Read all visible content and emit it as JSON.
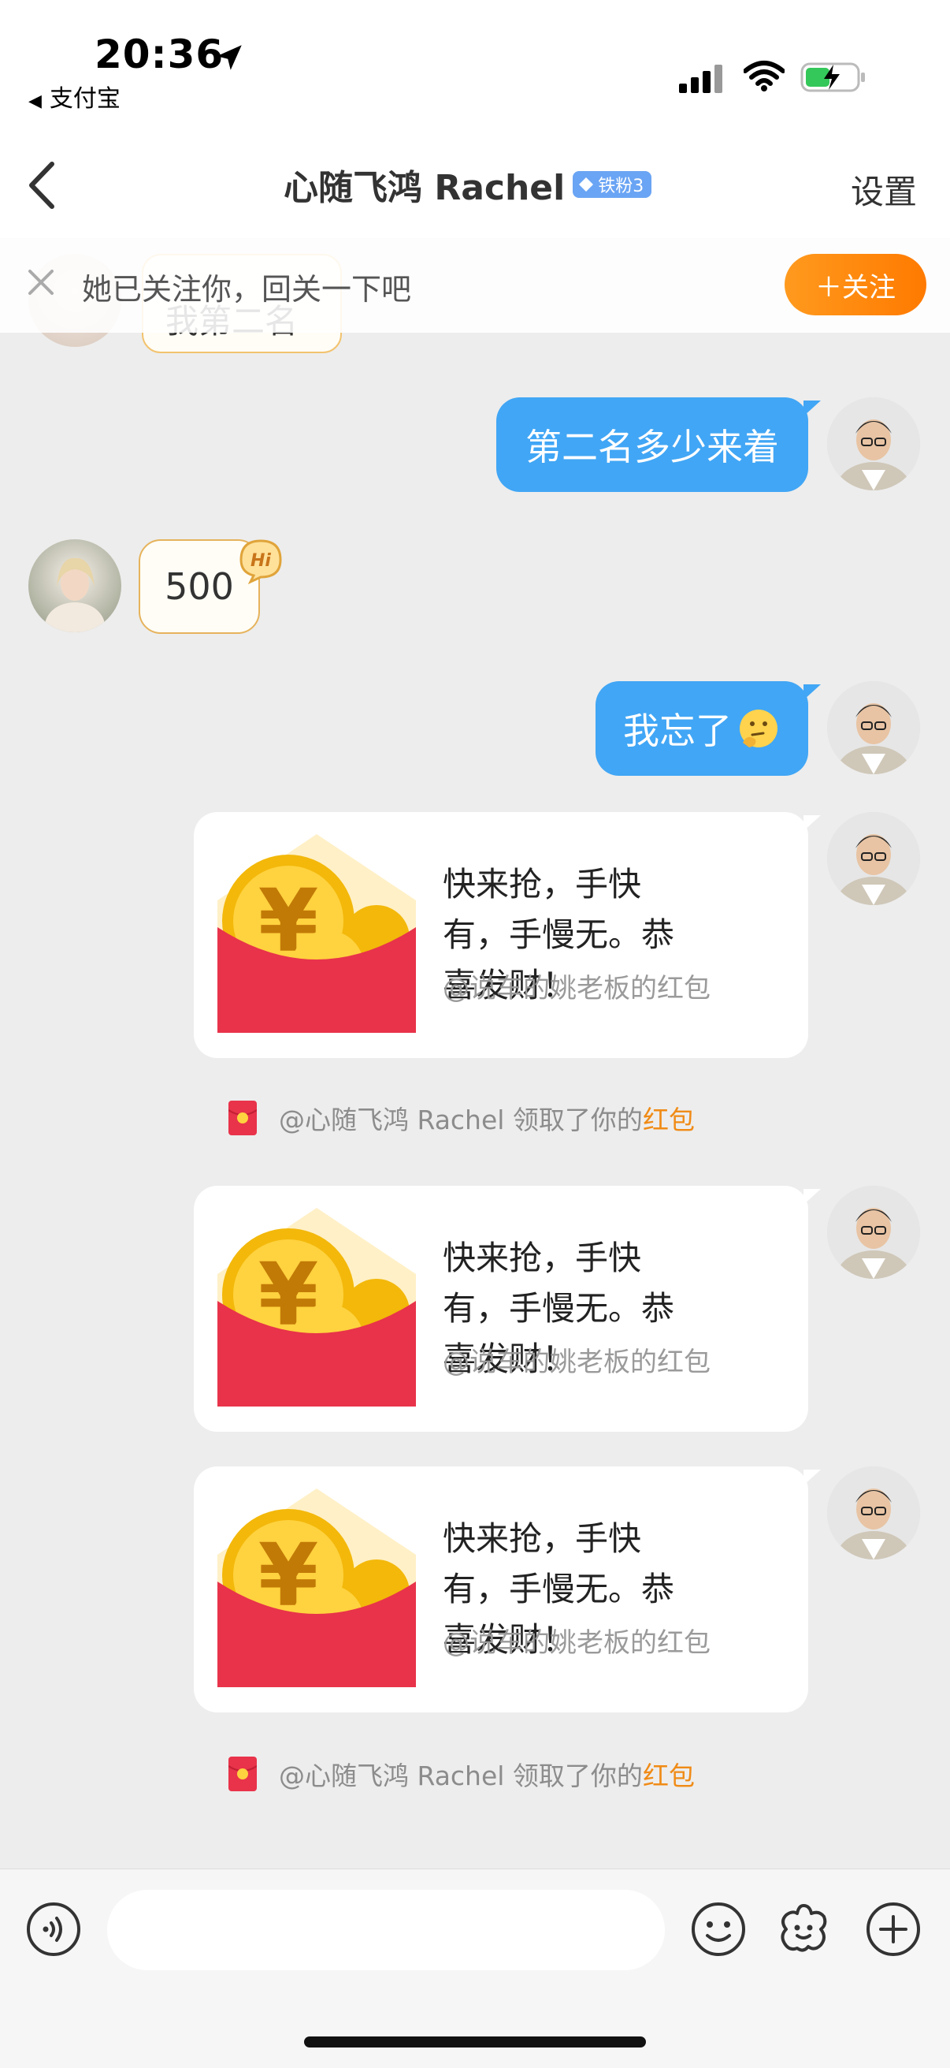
{
  "status_bar": {
    "time": "20:36",
    "back_app": "支付宝"
  },
  "nav": {
    "title": "心随飞鸿 Rachel",
    "fan_badge": "铁粉3",
    "settings": "设置"
  },
  "banner": {
    "text": "她已关注你，回关一下吧",
    "follow_button": "＋关注"
  },
  "hidden_message": {
    "text": "我第二名"
  },
  "messages": [
    {
      "from": "me",
      "type": "text",
      "text": "第二名多少来着"
    },
    {
      "from": "her",
      "type": "text",
      "text": "500",
      "sticker": "Hi"
    },
    {
      "from": "me",
      "type": "text",
      "text": "我忘了",
      "emoji": "thinking-face"
    },
    {
      "from": "me",
      "type": "red_packet",
      "text": "快来抢，手快有，手慢无。恭喜发财！",
      "sub": "@说车的姚老板的红包"
    },
    {
      "from": "system",
      "type": "notice",
      "prefix": "@心随飞鸿 Rachel 领取了你的",
      "highlight": "红包"
    },
    {
      "from": "me",
      "type": "red_packet",
      "text": "快来抢，手快有，手慢无。恭喜发财！",
      "sub": "@说车的姚老板的红包"
    },
    {
      "from": "me",
      "type": "red_packet",
      "text": "快来抢，手快有，手慢无。恭喜发财！",
      "sub": "@说车的姚老板的红包"
    },
    {
      "from": "system",
      "type": "notice",
      "prefix": "@心随飞鸿 Rachel 领取了你的",
      "highlight": "红包"
    }
  ],
  "bottom_bar": {
    "input_value": "",
    "icons": [
      "voice-icon",
      "emoji-icon",
      "sticker-icon",
      "plus-icon"
    ]
  },
  "colors": {
    "my_bubble": "#41a6f5",
    "accent_orange": "#ff8a10",
    "badge_blue": "#6aa4f4",
    "red_packet_red": "#e8334a"
  }
}
